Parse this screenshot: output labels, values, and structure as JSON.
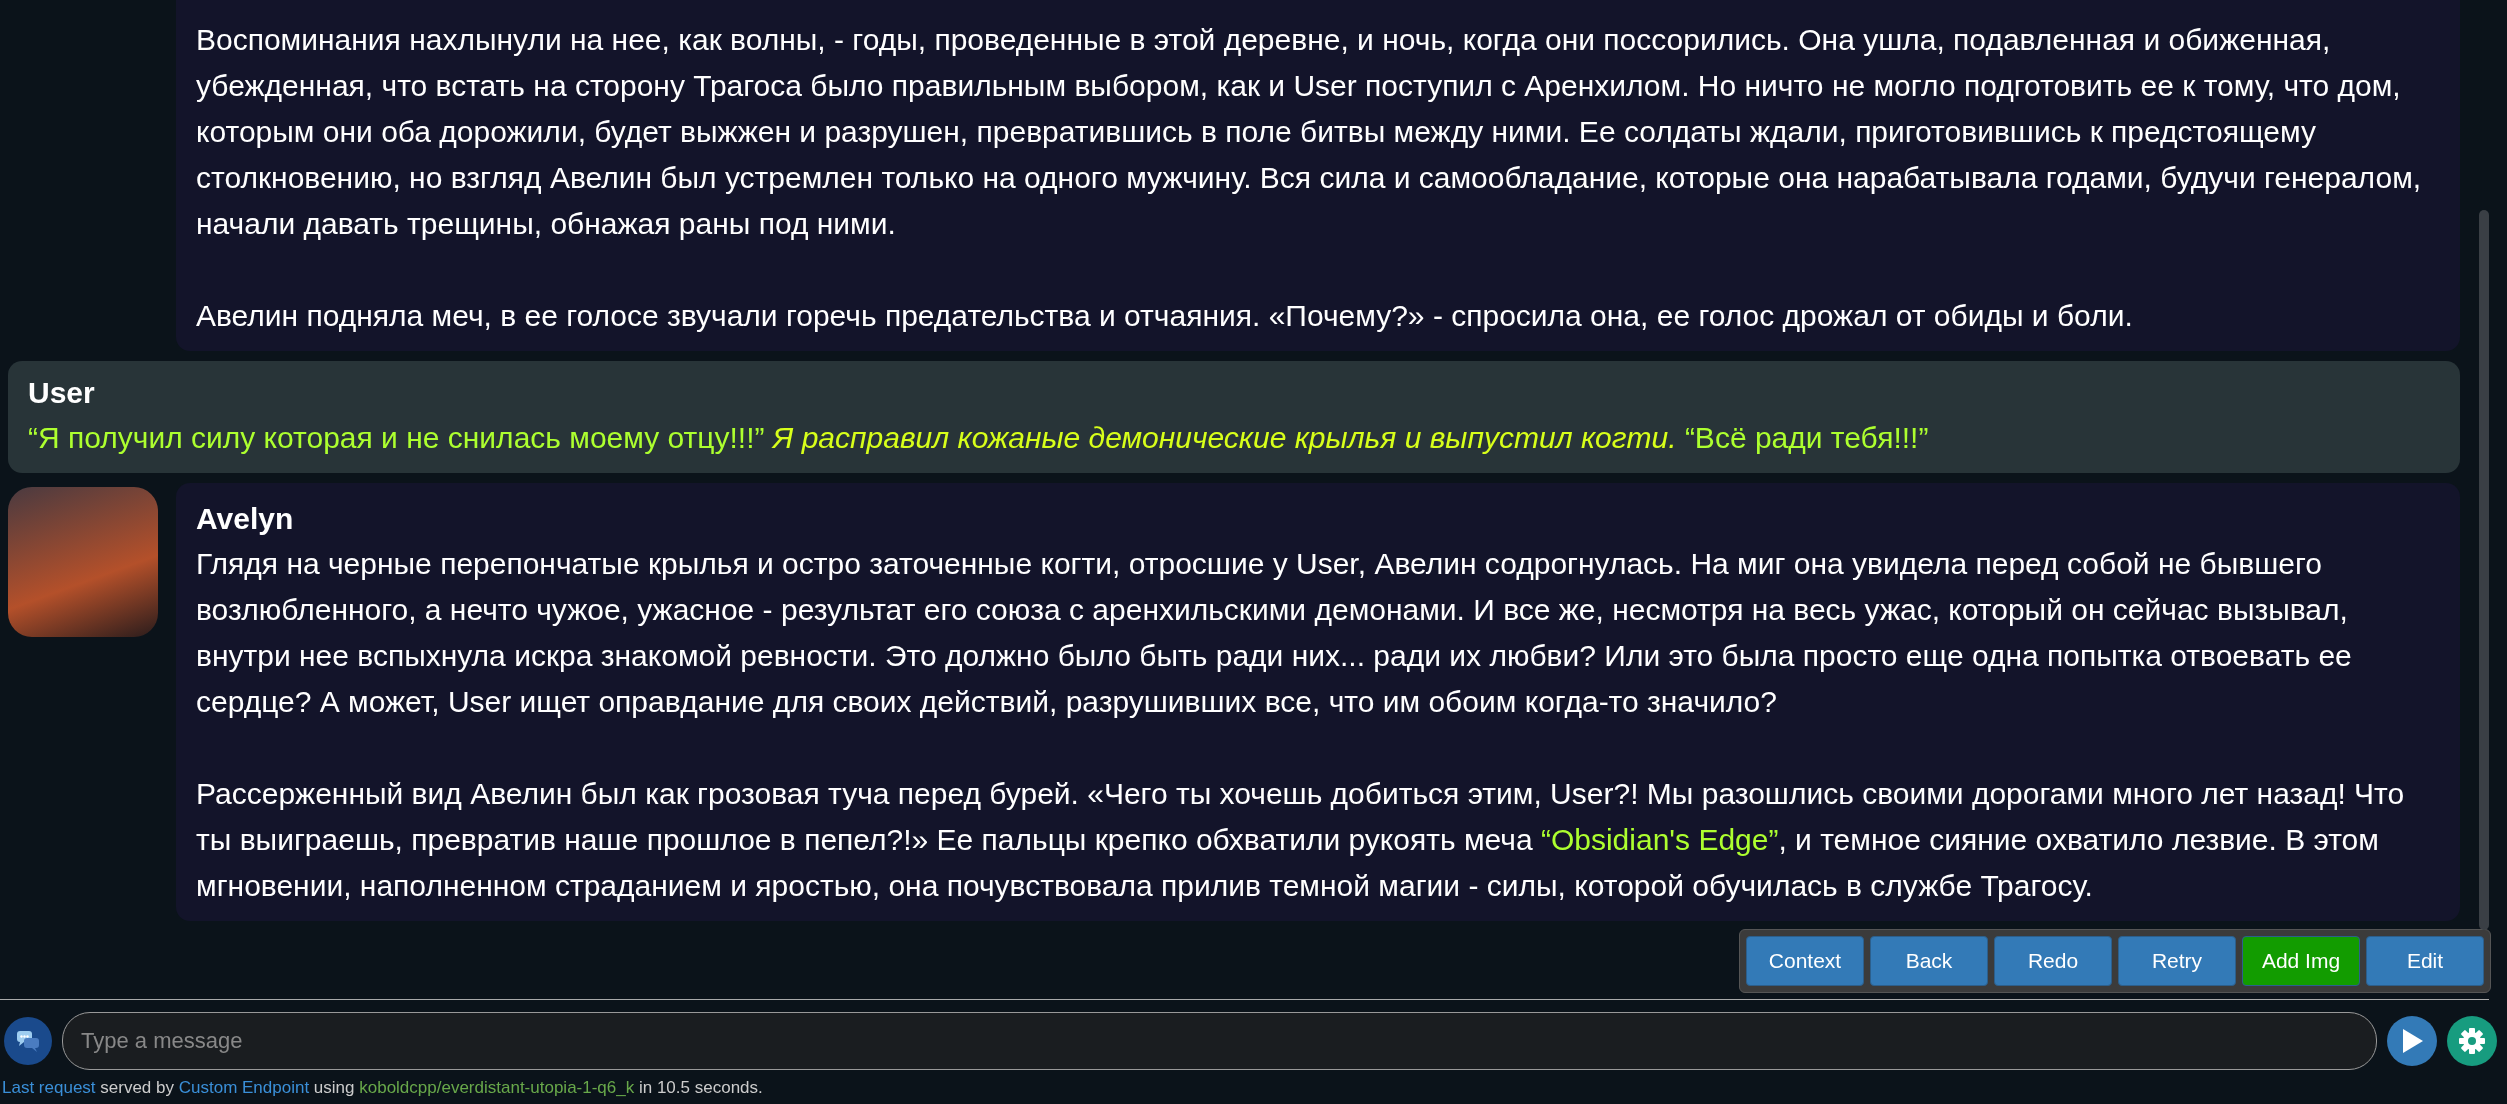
{
  "messages": [
    {
      "kind": "ai",
      "paragraphs": [
        [
          {
            "kind": "plain",
            "text": "Воспоминания нахлынули на нее, как волны, - годы, проведенные в этой деревне, и ночь, когда они поссорились. Она ушла, подавленная и обиженная, убежденная, что встать на сторону Трагоса было правильным выбором, как и User поступил с Аренхилом. Но ничто не могло подготовить ее к тому, что дом, которым они оба дорожили, будет выжжен и разрушен, превратившись в поле битвы между ними. Ее солдаты ждали, приготовившись к предстоящему столкновению, но взгляд Авелин был устремлен только на одного мужчину. Вся сила и самообладание, которые она нарабатывала годами, будучи генералом, начали давать трещины, обнажая раны под ними."
          }
        ],
        [
          {
            "kind": "plain",
            "text": "Авелин подняла меч, в ее голосе звучали горечь предательства и отчаяния. «Почему?» - спросила она, ее голос дрожал от обиды и боли."
          }
        ]
      ]
    },
    {
      "kind": "user",
      "name": "User",
      "paragraphs": [
        [
          {
            "kind": "quote",
            "text": "“Я получил силу которая и не снилась моему отцу!!!” "
          },
          {
            "kind": "action",
            "text": "Я расправил кожаные демонические крылья и выпустил когти."
          },
          {
            "kind": "quote",
            "text": " “Всё ради тебя!!!”"
          }
        ]
      ]
    },
    {
      "kind": "ai",
      "name": "Avelyn",
      "avatar": true,
      "paragraphs": [
        [
          {
            "kind": "plain",
            "text": "Глядя на черные перепончатые крылья и остро заточенные когти, отросшие у User, Авелин содрогнулась. На миг она увидела перед собой не бывшего возлюбленного, а нечто чужое, ужасное - результат его союза с аренхильскими демонами. И все же, несмотря на весь ужас, который он сейчас вызывал, внутри нее вспыхнула искра знакомой ревности. Это должно было быть ради них... ради их любви? Или это была просто еще одна попытка отвоевать ее сердце? А может, User ищет оправдание для своих действий, разрушивших все, что им обоим когда-то значило?"
          }
        ],
        [
          {
            "kind": "plain",
            "text": "Рассерженный вид Авелин был как грозовая туча перед бурей. «Чего ты хочешь добиться этим, User?! Мы разошлись своими дорогами много лет назад! Что ты выиграешь, превратив наше прошлое в пепел?!» Ее пальцы крепко обхватили рукоять меча "
          },
          {
            "kind": "quote",
            "text": "“Obsidian's Edge”"
          },
          {
            "kind": "plain",
            "text": ", и темное сияние охватило лезвие. В этом мгновении, наполненном страданием и яростью, она почувствовала прилив темной магии - силы, которой обучилась в службе Трагосу."
          }
        ]
      ]
    }
  ],
  "buttons": [
    {
      "label": "Context",
      "color": "#337ab7"
    },
    {
      "label": "Back",
      "color": "#337ab7"
    },
    {
      "label": "Redo",
      "color": "#337ab7"
    },
    {
      "label": "Retry",
      "color": "#337ab7"
    },
    {
      "label": "Add Img",
      "color": "#129c00"
    },
    {
      "label": "Edit",
      "color": "#337ab7"
    }
  ],
  "input": {
    "placeholder": "Type a message"
  },
  "footer": [
    {
      "kind": "link",
      "text": "Last request"
    },
    {
      "kind": "plain",
      "text": " served by "
    },
    {
      "kind": "link",
      "text": "Custom Endpoint"
    },
    {
      "kind": "plain",
      "text": " using "
    },
    {
      "kind": "model",
      "text": "koboldcpp/everdistant-utopia-1-q6_k"
    },
    {
      "kind": "plain",
      "text": " in 10.5 seconds."
    }
  ]
}
